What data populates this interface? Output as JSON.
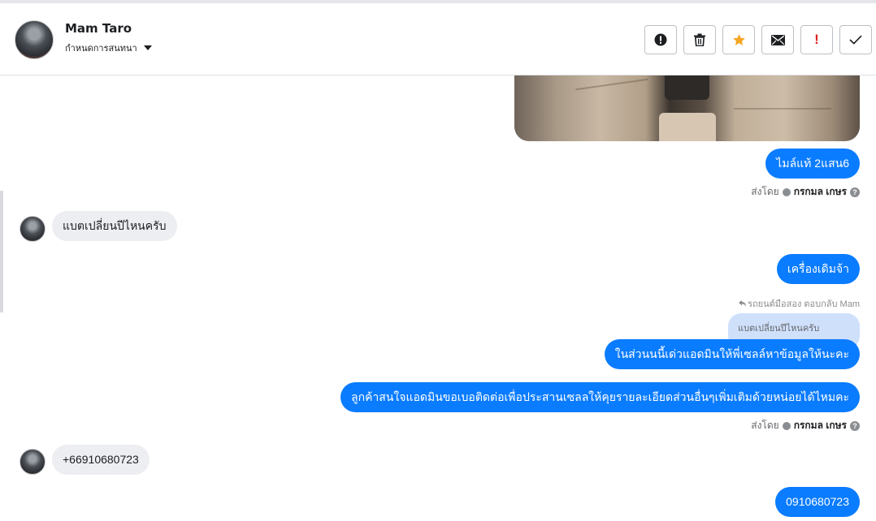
{
  "header": {
    "contact_name": "Mam Taro",
    "status_label": "กำหนดการสนทนา"
  },
  "toolbar": {
    "buttons": [
      "alert-icon",
      "trash-icon",
      "star-icon",
      "envelope-icon",
      "important-icon",
      "check-icon"
    ],
    "important_glyph": "!",
    "star_color": "#f5a623",
    "important_color": "#e02020"
  },
  "messages": {
    "m1": "ไมล์แท้ 2แสน6",
    "sent_by_label": "ส่งโดย",
    "sent_by_name": "กรกมล เกษร",
    "m2": "แบตเปลี่ยนปีไหนครับ",
    "m3": "เครื่องเดิมจ้า",
    "reply_note": "รถยนต์มือสอง ตอบกลับ Mam",
    "quoted_text": "แบตเปลี่ยนปีไหนครับ",
    "m4": "ในส่วนนนี้เด่วแอดมินให้พี่เซลล์หาข้อมูลให้นะคะ",
    "m5": "ลูกค้าสนใจแอดมินขอเบอติดต่อเพื่อประสานเซลลให้คุยรายละเอียดส่วนอื่นๆเพิ่มเติมด้วยหน่อยได้ไหมคะ",
    "sent_by_label_2": "ส่งโดย",
    "sent_by_name_2": "กรกมล เกษร",
    "m6": "+66910680723",
    "m7": "0910680723"
  },
  "colors": {
    "outgoing_bubble": "#0a7cff",
    "incoming_bubble": "#eceef1",
    "quote_bubble": "#cfe0fb"
  }
}
